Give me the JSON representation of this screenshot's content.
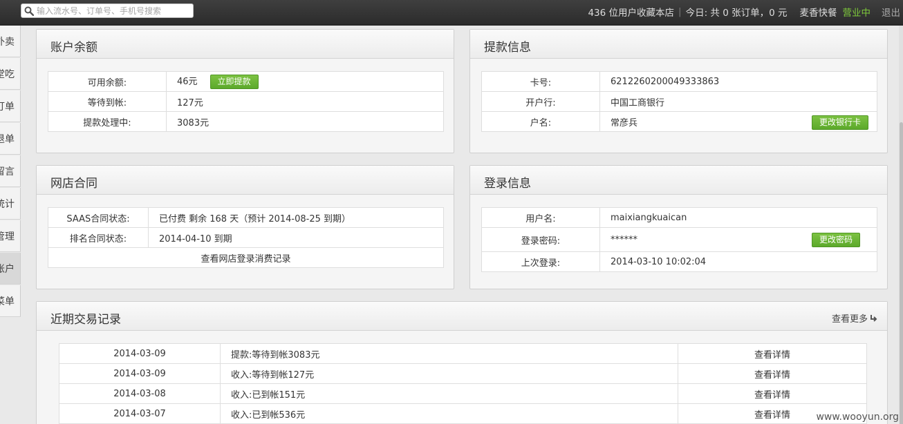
{
  "topbar": {
    "search_placeholder": "输入流水号、订单号、手机号搜索",
    "favorites": "436 位用户收藏本店",
    "today": "今日: 共 0 张订单，0 元",
    "shop_name": "麦香快餐",
    "status": "营业中",
    "logout": "退出"
  },
  "sidebar": {
    "items": [
      {
        "label": "外卖"
      },
      {
        "label": "堂吃"
      },
      {
        "label": "订单"
      },
      {
        "label": "退单"
      },
      {
        "label": "留言"
      },
      {
        "label": "统计"
      },
      {
        "label": "管理"
      },
      {
        "label": "账户"
      },
      {
        "label": "菜单"
      }
    ]
  },
  "balance": {
    "title": "账户余额",
    "available_label": "可用余额:",
    "available_value": "46元",
    "withdraw_button": "立即提款",
    "pending_label": "等待到帐:",
    "pending_value": "127元",
    "processing_label": "提款处理中:",
    "processing_value": "3083元"
  },
  "withdraw_info": {
    "title": "提款信息",
    "card_label": "卡号:",
    "card_value": "6212260200049333863",
    "bank_label": "开户行:",
    "bank_value": "中国工商银行",
    "holder_label": "户名:",
    "holder_value": "常彦兵",
    "change_card_button": "更改银行卡"
  },
  "contract": {
    "title": "网店合同",
    "saas_label": "SAAS合同状态:",
    "saas_value": "已付费 剩余 168 天（预计 2014-08-25 到期）",
    "rank_label": "排名合同状态:",
    "rank_value": "2014-04-10 到期",
    "records_link": "查看网店登录消费记录"
  },
  "login_info": {
    "title": "登录信息",
    "username_label": "用户名:",
    "username_value": "maixiangkuaican",
    "password_label": "登录密码:",
    "password_value": "******",
    "change_password_button": "更改密码",
    "last_login_label": "上次登录:",
    "last_login_value": "2014-03-10 10:02:04"
  },
  "transactions": {
    "title": "近期交易记录",
    "more": "查看更多",
    "rows": [
      {
        "date": "2014-03-09",
        "desc": "提款:等待到帐3083元",
        "action": "查看详情"
      },
      {
        "date": "2014-03-09",
        "desc": "收入:等待到帐127元",
        "action": "查看详情"
      },
      {
        "date": "2014-03-08",
        "desc": "收入:已到帐151元",
        "action": "查看详情"
      },
      {
        "date": "2014-03-07",
        "desc": "收入:已到帐536元",
        "action": "查看详情"
      }
    ]
  },
  "watermark": "www.wooyun.org"
}
